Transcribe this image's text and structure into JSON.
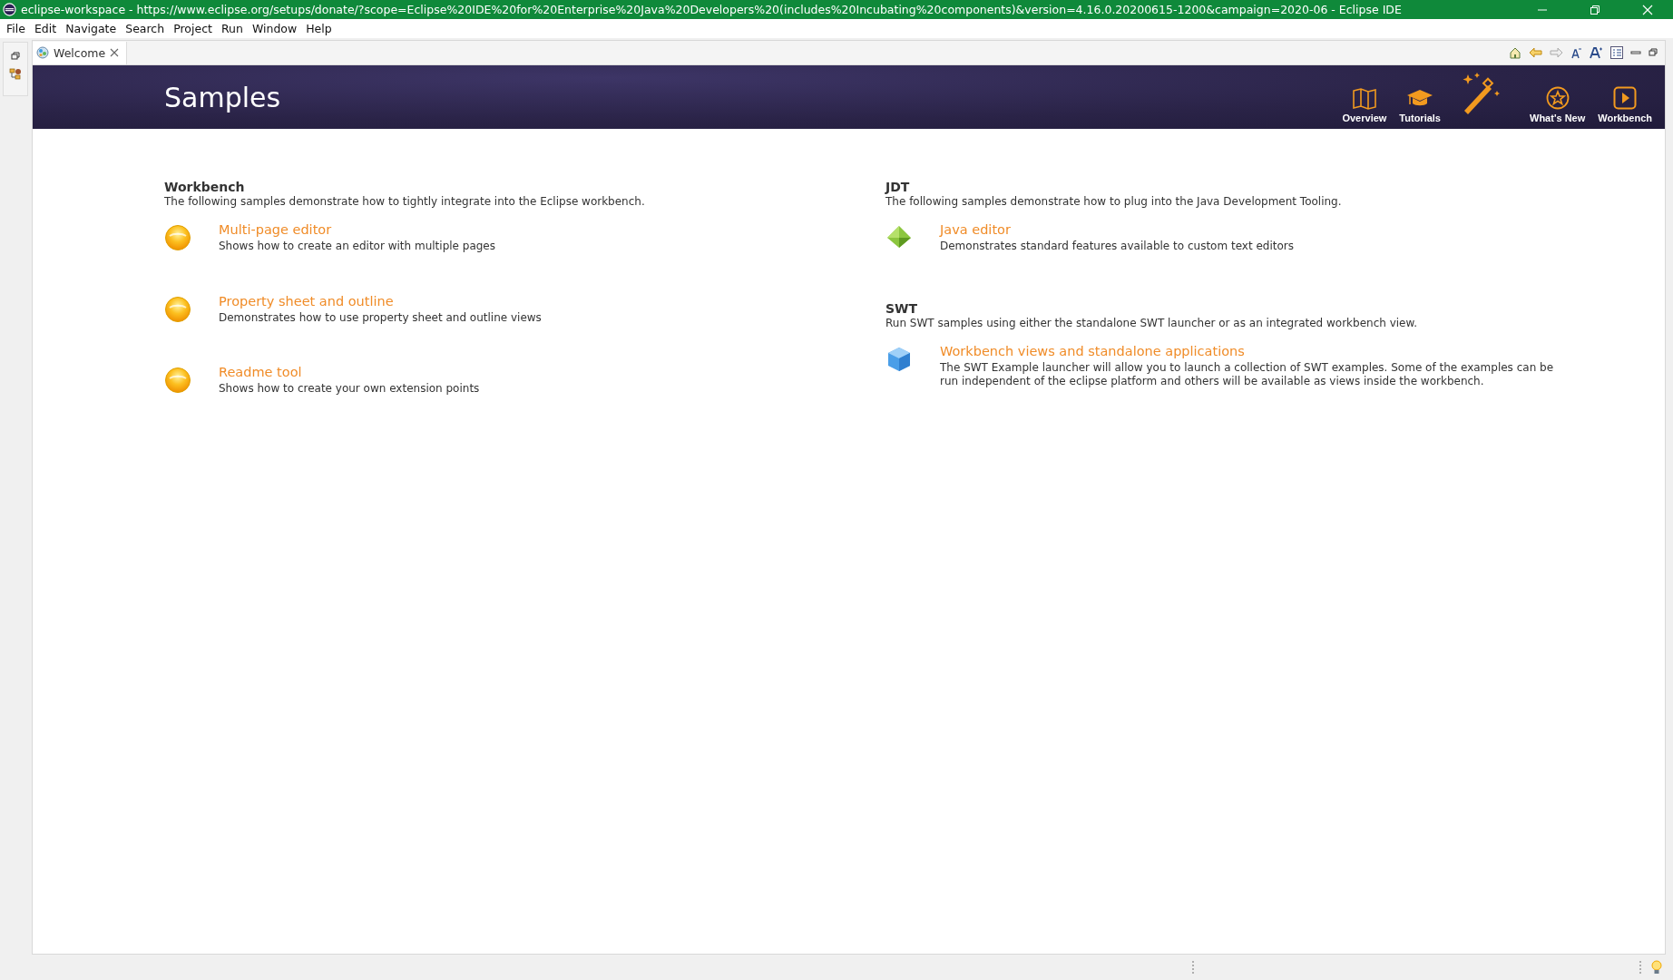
{
  "window": {
    "title": "eclipse-workspace - https://www.eclipse.org/setups/donate/?scope=Eclipse%20IDE%20for%20Enterprise%20Java%20Developers%20(includes%20Incubating%20components)&version=4.16.0.20200615-1200&campaign=2020-06 - Eclipse IDE"
  },
  "menu": [
    "File",
    "Edit",
    "Navigate",
    "Search",
    "Project",
    "Run",
    "Window",
    "Help"
  ],
  "tabs": [
    {
      "label": "Welcome",
      "selected": true
    }
  ],
  "banner": {
    "title": "Samples",
    "nav": [
      {
        "kind": "map",
        "label": "Overview"
      },
      {
        "kind": "cap",
        "label": "Tutorials"
      },
      {
        "kind": "wand"
      },
      {
        "kind": "star",
        "label": "What's New"
      },
      {
        "kind": "play",
        "label": "Workbench"
      }
    ]
  },
  "columns": [
    [
      {
        "heading": "Workbench",
        "description": "The following samples demonstrate how to tightly integrate into the Eclipse workbench.",
        "items": [
          {
            "kind": "sphere",
            "title": "Multi-page editor",
            "description": "Shows how to create an editor with multiple pages"
          },
          {
            "kind": "sphere",
            "title": "Property sheet and outline",
            "description": "Demonstrates how to use property sheet and outline views"
          },
          {
            "kind": "sphere",
            "title": "Readme tool",
            "description": "Shows how to create your own extension points"
          }
        ]
      }
    ],
    [
      {
        "heading": "JDT",
        "description": "The following samples demonstrate how to plug into the Java Development Tooling.",
        "items": [
          {
            "kind": "gem",
            "title": "Java editor",
            "description": "Demonstrates standard features available to custom text editors"
          }
        ]
      },
      {
        "heading": "SWT",
        "description": "Run SWT samples using either the standalone SWT launcher or as an integrated workbench view.",
        "items": [
          {
            "kind": "cube",
            "title": "Workbench views and standalone applications",
            "description": "The SWT Example launcher will allow you to launch a collection of SWT examples. Some of the examples can be run independent of the eclipse platform and others will be available as views inside the workbench."
          }
        ]
      }
    ]
  ]
}
